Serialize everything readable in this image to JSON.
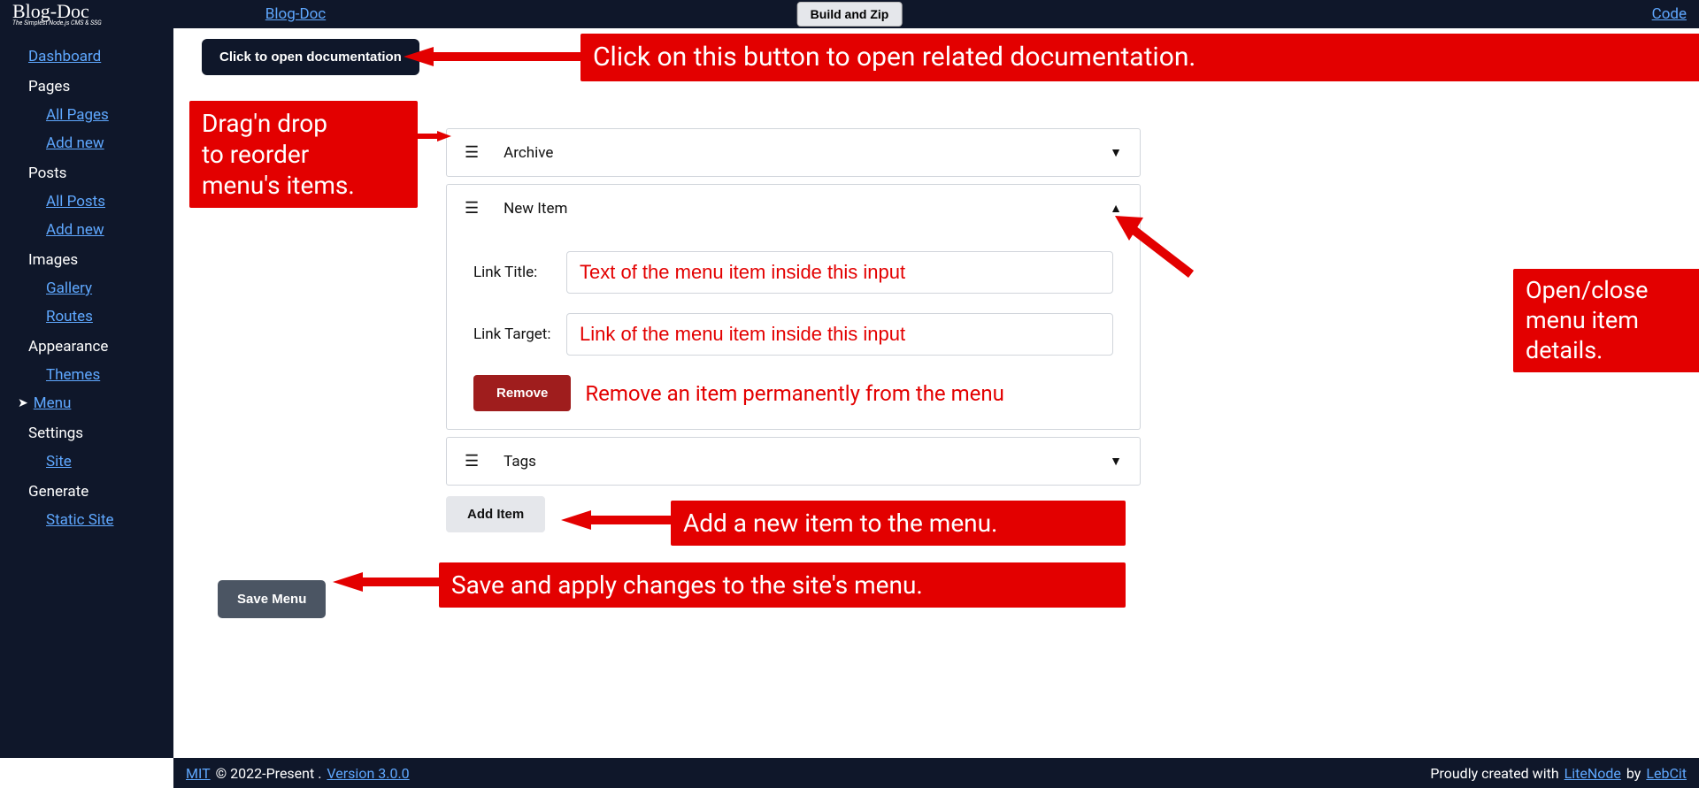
{
  "brand": {
    "name": "Blog-Doc",
    "tagline": "The Simplest Node.js CMS & SSG"
  },
  "topbar": {
    "left_link": "Blog-Doc",
    "build_zip": "Build and Zip",
    "code_link": "Code"
  },
  "sidebar": {
    "dashboard": "Dashboard",
    "pages": "Pages",
    "all_pages": "All Pages",
    "add_new_page": "Add new",
    "posts": "Posts",
    "all_posts": "All Posts",
    "add_new_post": "Add new",
    "images": "Images",
    "gallery": "Gallery",
    "routes": "Routes",
    "appearance": "Appearance",
    "themes": "Themes",
    "menu": "Menu",
    "settings": "Settings",
    "site": "Site",
    "generate": "Generate",
    "static_site": "Static Site"
  },
  "buttons": {
    "open_doc": "Click to open documentation",
    "add_item": "Add Item",
    "save_menu": "Save Menu",
    "remove": "Remove"
  },
  "menu_items": [
    {
      "title": "Archive",
      "expanded": false
    },
    {
      "title": "New Item",
      "expanded": true,
      "link_title_label": "Link Title:",
      "link_title_value": "Text of the menu item inside this input",
      "link_target_label": "Link Target:",
      "link_target_value": "Link of the menu item inside this input"
    },
    {
      "title": "Tags",
      "expanded": false
    }
  ],
  "callouts": {
    "doc_button": "Click on this button to open related documentation.",
    "drag_drop": "Drag'n drop\nto reorder\nmenu's items.",
    "open_close": "Open/close\nmenu item\ndetails.",
    "remove_note": "Remove an item permanently from the menu",
    "add_item": "Add a new item to the menu.",
    "save_menu": "Save and apply changes to the site's menu."
  },
  "footer": {
    "mit": "MIT",
    "copyright": "© 2022-Present .",
    "version": "Version 3.0.0",
    "proudly": "Proudly created with",
    "litenode": "LiteNode",
    "by": "by",
    "lebcit": "LebCit"
  }
}
